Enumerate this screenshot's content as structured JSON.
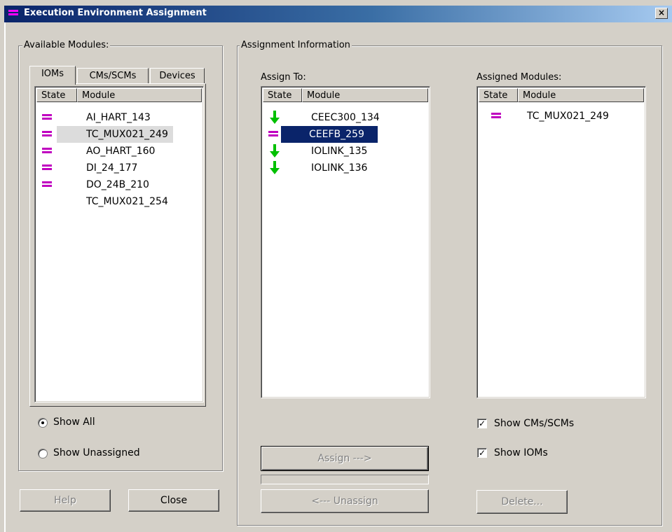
{
  "window": {
    "title": "Execution Environment Assignment",
    "close_glyph": "×"
  },
  "available": {
    "legend": "Available Modules:",
    "tabs": [
      {
        "label": "IOMs",
        "active": true
      },
      {
        "label": "CMs/SCMs",
        "active": false
      },
      {
        "label": "Devices",
        "active": false
      }
    ],
    "columns": [
      "State",
      "Module"
    ],
    "rows": [
      {
        "state": "equal-icon",
        "module": "AI_HART_143"
      },
      {
        "state": "equal-icon",
        "module": "TC_MUX021_249",
        "selected": true
      },
      {
        "state": "equal-icon",
        "module": "AO_HART_160"
      },
      {
        "state": "equal-icon",
        "module": "DI_24_177"
      },
      {
        "state": "equal-icon",
        "module": "DO_24B_210"
      },
      {
        "state": "",
        "module": "TC_MUX021_254"
      }
    ],
    "radios": [
      {
        "label": "Show All",
        "checked": true
      },
      {
        "label": "Show Unassigned",
        "checked": false
      }
    ]
  },
  "assignment": {
    "legend": "Assignment Information",
    "assign_to": {
      "label": "Assign To:",
      "columns": [
        "State",
        "Module"
      ],
      "rows": [
        {
          "state": "down-arrow-icon",
          "module": "CEEC300_134"
        },
        {
          "state": "equal-icon",
          "module": "CEEFB_259",
          "selected": true
        },
        {
          "state": "down-arrow-icon",
          "module": "IOLINK_135"
        },
        {
          "state": "down-arrow-icon",
          "module": "IOLINK_136"
        }
      ]
    },
    "assigned": {
      "label": "Assigned Modules:",
      "columns": [
        "State",
        "Module"
      ],
      "rows": [
        {
          "state": "equal-icon",
          "module": "TC_MUX021_249"
        }
      ]
    },
    "assign_button": "Assign --->",
    "unassign_button": "<--- Unassign",
    "delete_button": "Delete...",
    "checkboxes": [
      {
        "label": "Show CMs/SCMs",
        "checked": true
      },
      {
        "label": "Show IOMs",
        "checked": true
      }
    ]
  },
  "footer": {
    "help_button": "Help",
    "close_button": "Close"
  },
  "colors": {
    "state_equal": "#c000c0",
    "state_arrow": "#00c000",
    "selection": "#0a246a"
  }
}
